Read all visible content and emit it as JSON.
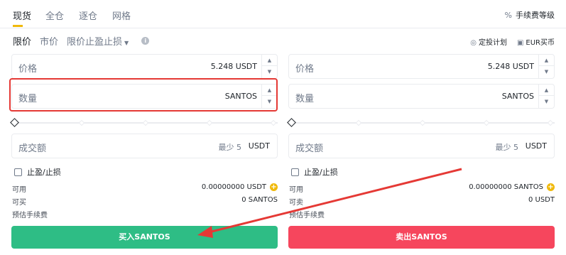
{
  "tabs": [
    {
      "label": "现货",
      "active": true
    },
    {
      "label": "全仓",
      "active": false
    },
    {
      "label": "逐仓",
      "active": false
    },
    {
      "label": "网格",
      "active": false
    }
  ],
  "fee_level_label": "手续费等级",
  "order_types": {
    "limit": "限价",
    "market": "市价",
    "stop_limit": "限价止盈止损"
  },
  "right_links": {
    "auto_invest": "定投计划",
    "eur_buy": "EUR买币"
  },
  "buy": {
    "price_label": "价格",
    "price_value": "5.248  USDT",
    "qty_label": "数量",
    "qty_value": "SANTOS",
    "total_label": "成交额",
    "total_min": "最少 5",
    "total_unit": "USDT",
    "sl_label": "止盈/止损",
    "avail_key": "可用",
    "avail_val": "0.00000000 USDT",
    "can_key": "可买",
    "can_val": "0 SANTOS",
    "fee_key": "预估手续费",
    "button": "买入SANTOS"
  },
  "sell": {
    "price_label": "价格",
    "price_value": "5.248  USDT",
    "qty_label": "数量",
    "qty_value": "SANTOS",
    "total_label": "成交额",
    "total_min": "最少 5",
    "total_unit": "USDT",
    "sl_label": "止盈/止损",
    "avail_key": "可用",
    "avail_val": "0.00000000 SANTOS",
    "can_key": "可卖",
    "can_val": "0 USDT",
    "fee_key": "预估手续费",
    "button": "卖出SANTOS"
  },
  "colors": {
    "accent": "#f0b90b",
    "buy": "#2ebd85",
    "sell": "#f6465d",
    "annotation": "#e53935"
  }
}
